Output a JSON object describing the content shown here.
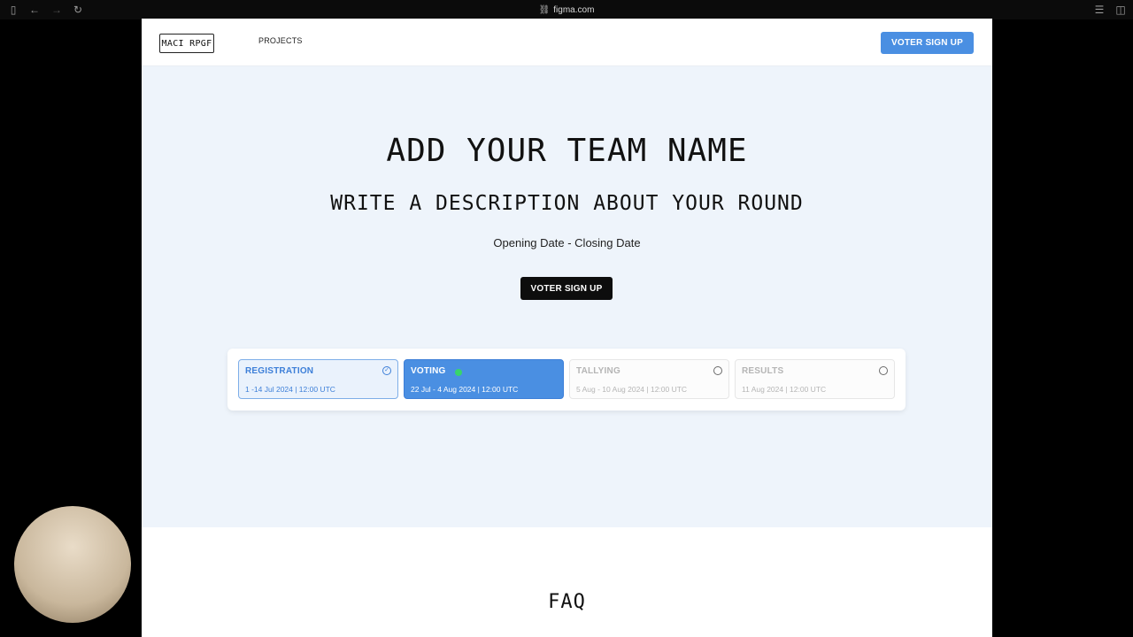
{
  "browser": {
    "url": "figma.com"
  },
  "nav": {
    "logo_text": "MACI RPGF",
    "projects_link": "PROJECTS",
    "signup_button": "VOTER SIGN UP"
  },
  "hero": {
    "title": "ADD YOUR TEAM NAME",
    "subtitle": "WRITE A DESCRIPTION ABOUT YOUR ROUND",
    "dates": "Opening Date - Closing Date",
    "cta_button": "VOTER SIGN UP"
  },
  "stages": [
    {
      "name": "REGISTRATION",
      "date": "1 -14 Jul 2024 | 12:00 UTC",
      "status": "complete",
      "icon": "check-circle-icon"
    },
    {
      "name": "VOTING",
      "date": "22 Jul - 4 Aug 2024 | 12:00 UTC",
      "status": "active",
      "icon": "live-dot-icon"
    },
    {
      "name": "TALLYING",
      "date": "5 Aug - 10 Aug 2024 | 12:00 UTC",
      "status": "upcoming",
      "icon": "empty-circle-icon"
    },
    {
      "name": "RESULTS",
      "date": "11 Aug 2024 | 12:00 UTC",
      "status": "upcoming",
      "icon": "empty-circle-icon"
    }
  ],
  "faq": {
    "title": "FAQ"
  },
  "colors": {
    "accent_blue": "#4a8fe2",
    "hero_bg": "#eef4fb",
    "live_green": "#38d46b"
  }
}
